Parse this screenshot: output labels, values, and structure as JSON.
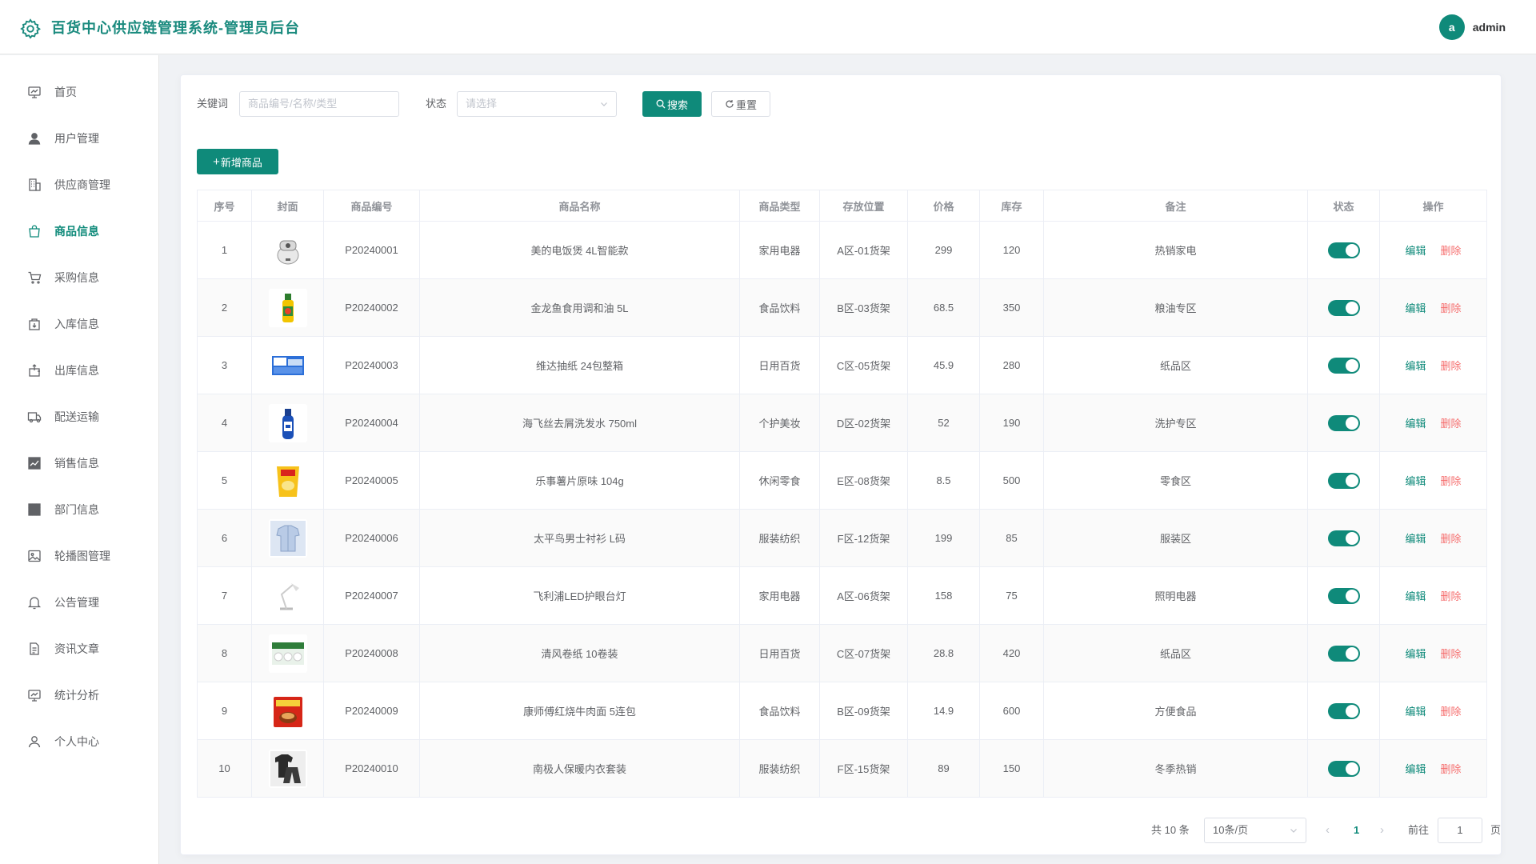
{
  "header": {
    "title": "百货中心供应链管理系统-管理员后台",
    "avatar_letter": "a",
    "username": "admin"
  },
  "sidebar": {
    "active_index": 3,
    "items": [
      {
        "label": "首页",
        "icon": "dashboard-icon"
      },
      {
        "label": "用户管理",
        "icon": "user-icon"
      },
      {
        "label": "供应商管理",
        "icon": "building-icon"
      },
      {
        "label": "商品信息",
        "icon": "shopping-bag-icon"
      },
      {
        "label": "采购信息",
        "icon": "cart-icon"
      },
      {
        "label": "入库信息",
        "icon": "box-in-icon"
      },
      {
        "label": "出库信息",
        "icon": "box-out-icon"
      },
      {
        "label": "配送运输",
        "icon": "truck-icon"
      },
      {
        "label": "销售信息",
        "icon": "chart-icon"
      },
      {
        "label": "部门信息",
        "icon": "grid-icon"
      },
      {
        "label": "轮播图管理",
        "icon": "image-icon"
      },
      {
        "label": "公告管理",
        "icon": "bell-icon"
      },
      {
        "label": "资讯文章",
        "icon": "document-icon"
      },
      {
        "label": "统计分析",
        "icon": "stats-icon"
      },
      {
        "label": "个人中心",
        "icon": "person-icon"
      }
    ]
  },
  "filters": {
    "keyword_label": "关键词",
    "keyword_placeholder": "商品编号/名称/类型",
    "status_label": "状态",
    "status_placeholder": "请选择",
    "search_label": "搜索",
    "reset_label": "重置",
    "add_label": "新增商品"
  },
  "table": {
    "headers": [
      "序号",
      "封面",
      "商品编号",
      "商品名称",
      "商品类型",
      "存放位置",
      "价格",
      "库存",
      "备注",
      "状态",
      "操作"
    ],
    "edit_label": "编辑",
    "delete_label": "删除",
    "rows": [
      {
        "index": "1",
        "code": "P20240001",
        "name": "美的电饭煲 4L智能款",
        "type": "家用电器",
        "location": "A区-01货架",
        "price": "299",
        "stock": "120",
        "note": "热销家电",
        "status": true,
        "cover": "rice-cooker"
      },
      {
        "index": "2",
        "code": "P20240002",
        "name": "金龙鱼食用调和油 5L",
        "type": "食品饮料",
        "location": "B区-03货架",
        "price": "68.5",
        "stock": "350",
        "note": "粮油专区",
        "status": true,
        "cover": "oil-bottle"
      },
      {
        "index": "3",
        "code": "P20240003",
        "name": "维达抽纸 24包整箱",
        "type": "日用百货",
        "location": "C区-05货架",
        "price": "45.9",
        "stock": "280",
        "note": "纸品区",
        "status": true,
        "cover": "tissue-box"
      },
      {
        "index": "4",
        "code": "P20240004",
        "name": "海飞丝去屑洗发水 750ml",
        "type": "个护美妆",
        "location": "D区-02货架",
        "price": "52",
        "stock": "190",
        "note": "洗护专区",
        "status": true,
        "cover": "shampoo"
      },
      {
        "index": "5",
        "code": "P20240005",
        "name": "乐事薯片原味 104g",
        "type": "休闲零食",
        "location": "E区-08货架",
        "price": "8.5",
        "stock": "500",
        "note": "零食区",
        "status": true,
        "cover": "chips"
      },
      {
        "index": "6",
        "code": "P20240006",
        "name": "太平鸟男士衬衫 L码",
        "type": "服装纺织",
        "location": "F区-12货架",
        "price": "199",
        "stock": "85",
        "note": "服装区",
        "status": true,
        "cover": "shirt"
      },
      {
        "index": "7",
        "code": "P20240007",
        "name": "飞利浦LED护眼台灯",
        "type": "家用电器",
        "location": "A区-06货架",
        "price": "158",
        "stock": "75",
        "note": "照明电器",
        "status": true,
        "cover": "desk-lamp"
      },
      {
        "index": "8",
        "code": "P20240008",
        "name": "清风卷纸 10卷装",
        "type": "日用百货",
        "location": "C区-07货架",
        "price": "28.8",
        "stock": "420",
        "note": "纸品区",
        "status": true,
        "cover": "toilet-paper"
      },
      {
        "index": "9",
        "code": "P20240009",
        "name": "康师傅红烧牛肉面 5连包",
        "type": "食品饮料",
        "location": "B区-09货架",
        "price": "14.9",
        "stock": "600",
        "note": "方便食品",
        "status": true,
        "cover": "noodles"
      },
      {
        "index": "10",
        "code": "P20240010",
        "name": "南极人保暖内衣套装",
        "type": "服装纺织",
        "location": "F区-15货架",
        "price": "89",
        "stock": "150",
        "note": "冬季热销",
        "status": true,
        "cover": "thermal-wear"
      }
    ]
  },
  "pagination": {
    "total_text": "共 10 条",
    "page_size": "10条/页",
    "current_page": "1",
    "goto_label": "前往",
    "goto_value": "1",
    "page_suffix": "页"
  },
  "colors": {
    "primary": "#0f8a7a",
    "danger": "#f56c6c",
    "title": "#1a8a7e"
  }
}
